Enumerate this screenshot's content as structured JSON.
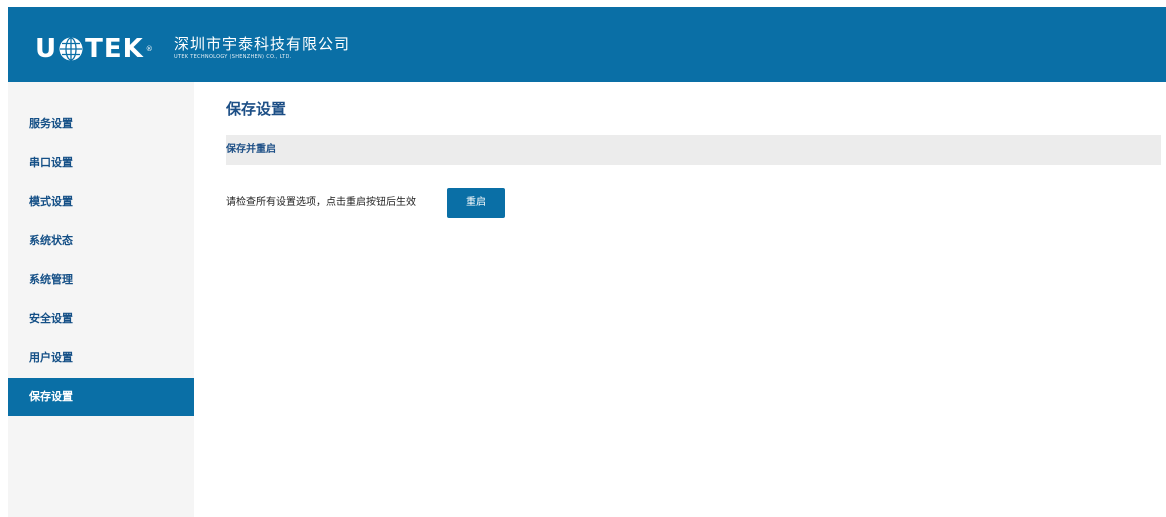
{
  "header": {
    "logo_left": "U",
    "logo_right": "TEK",
    "logo_tm": "®",
    "company_name_cn": "深圳市宇泰科技有限公司",
    "company_name_en": "UTEK TECHNOLOGY (SHENZHEN) CO., LTD.",
    "background_color": "#0a6fa6"
  },
  "sidebar": {
    "items": [
      {
        "label": "服务设置",
        "active": false
      },
      {
        "label": "串口设置",
        "active": false
      },
      {
        "label": "模式设置",
        "active": false
      },
      {
        "label": "系统状态",
        "active": false
      },
      {
        "label": "系统管理",
        "active": false
      },
      {
        "label": "安全设置",
        "active": false
      },
      {
        "label": "用户设置",
        "active": false
      },
      {
        "label": "保存设置",
        "active": true
      }
    ],
    "active_color": "#0a6fa6",
    "text_color": "#144f86"
  },
  "main": {
    "title": "保存设置",
    "section_title": "保存并重启",
    "hint": "请检查所有设置选项，点击重启按钮后生效",
    "restart_button_label": "重启"
  }
}
